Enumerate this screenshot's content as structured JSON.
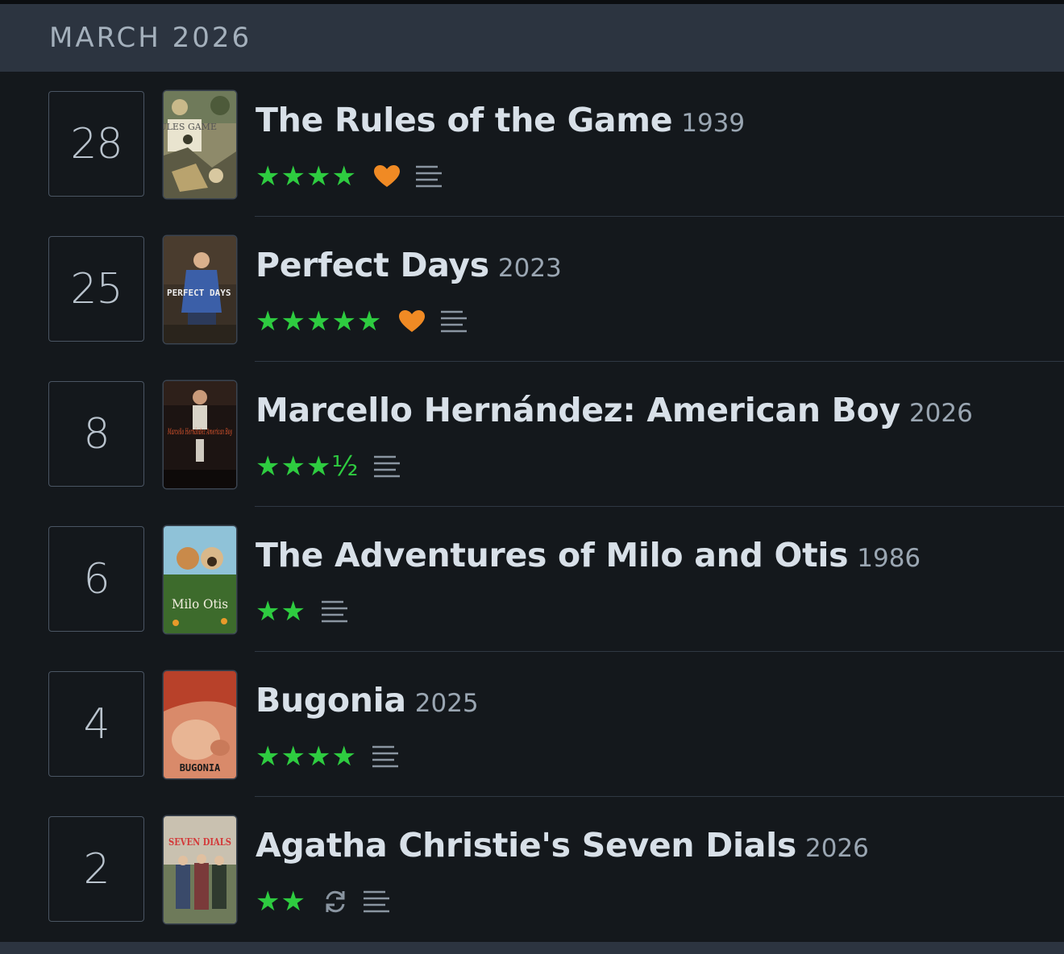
{
  "header": {
    "month": "MARCH 2026"
  },
  "entries": [
    {
      "day": "28",
      "title": "The Rules of the Game",
      "year": "1939",
      "stars": "★★★★",
      "liked": true,
      "rewatch": false,
      "review": true,
      "poster_text": "RULES GAME"
    },
    {
      "day": "25",
      "title": "Perfect Days",
      "year": "2023",
      "stars": "★★★★★",
      "liked": true,
      "rewatch": false,
      "review": true,
      "poster_text": "PERFECT DAYS"
    },
    {
      "day": "8",
      "title": "Marcello Hernández: American Boy",
      "year": "2026",
      "stars": "★★★½",
      "liked": false,
      "rewatch": false,
      "review": true,
      "poster_text": "Marcello Hernández American Boy"
    },
    {
      "day": "6",
      "title": "The Adventures of Milo and Otis",
      "year": "1986",
      "stars": "★★",
      "liked": false,
      "rewatch": false,
      "review": true,
      "poster_text": "Milo Otis"
    },
    {
      "day": "4",
      "title": "Bugonia",
      "year": "2025",
      "stars": "★★★★",
      "liked": false,
      "rewatch": false,
      "review": true,
      "poster_text": "BUGONIA"
    },
    {
      "day": "2",
      "title": "Agatha Christie's Seven Dials",
      "year": "2026",
      "stars": "★★",
      "liked": false,
      "rewatch": true,
      "review": true,
      "poster_text": "SEVEN DIALS"
    }
  ],
  "colors": {
    "background": "#14181c",
    "header_bg": "#2c3440",
    "star_green": "#2ecc40",
    "heart_orange": "#f08a24",
    "icon_gray": "#8a95a1"
  },
  "icons": {
    "heart": "heart-icon",
    "review": "review-lines-icon",
    "rewatch": "rewatch-icon"
  }
}
